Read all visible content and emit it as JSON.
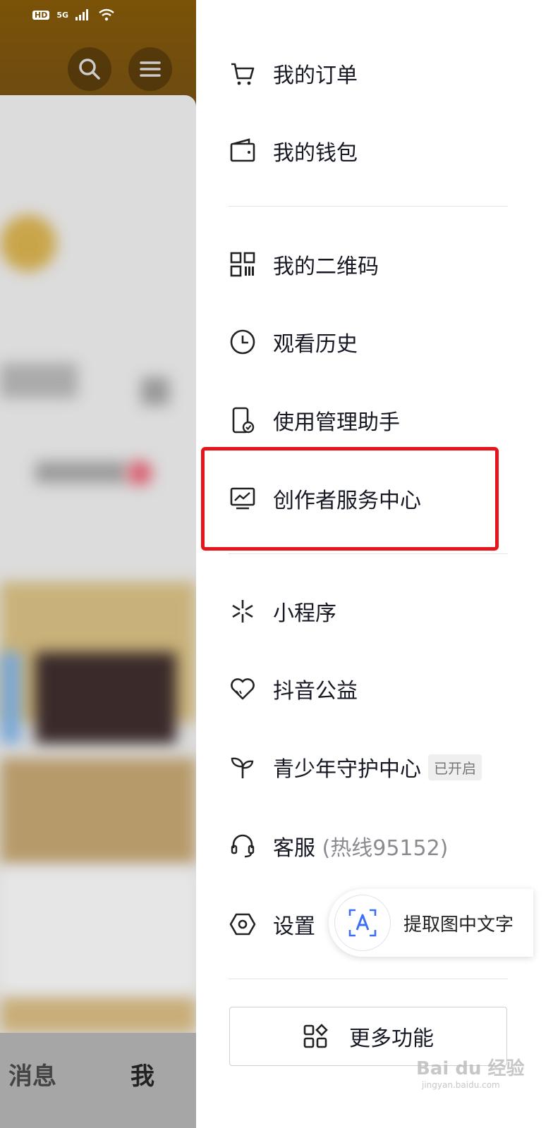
{
  "status_bar": {
    "network_hd": "HD",
    "network_5g": "5G"
  },
  "colors": {
    "highlight": "#e8141c",
    "accent": "#3d6ff5"
  },
  "background_nav": {
    "msg_label": "消息",
    "me_label": "我"
  },
  "menu": {
    "orders": "我的订单",
    "wallet": "我的钱包",
    "qrcode": "我的二维码",
    "history": "观看历史",
    "assistant": "使用管理助手",
    "creator": "创作者服务中心",
    "mini_program": "小程序",
    "charity": "抖音公益",
    "youth": "青少年守护中心",
    "youth_badge": "已开启",
    "service": "客服",
    "service_hotline": "(热线95152)",
    "settings": "设置"
  },
  "ocr_popup": {
    "label": "提取图中文字"
  },
  "more_functions": "更多功能",
  "watermark": {
    "brand": "Bai du 经验",
    "url": "jingyan.baidu.com"
  }
}
